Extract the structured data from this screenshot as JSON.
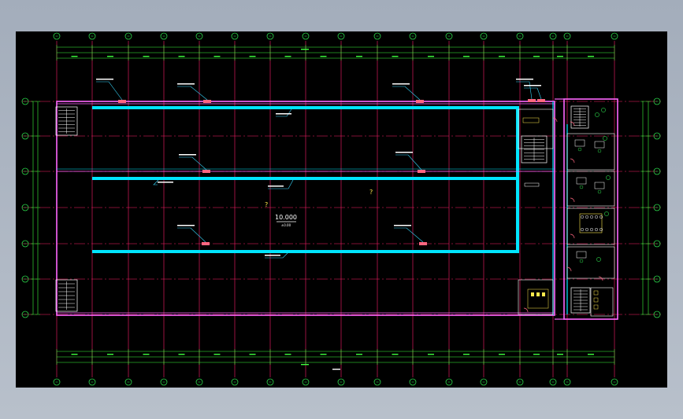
{
  "drawing": {
    "center_label": "10.000",
    "center_sublabel": "±0.00",
    "question_marks": [
      "?",
      "?"
    ],
    "colors": {
      "background": "#000000",
      "frame": "#a3adbb",
      "grid_line": "#ff1f6b",
      "axis_bubble": "#2bd64a",
      "wall": "#ff66ff",
      "corridor": "#00e5ff",
      "dimension": "#3dff3d",
      "leader": "#37d9ff",
      "fixture": "#ffe94d",
      "equipment": "#ff6680",
      "annotation": "#ffffff"
    }
  }
}
